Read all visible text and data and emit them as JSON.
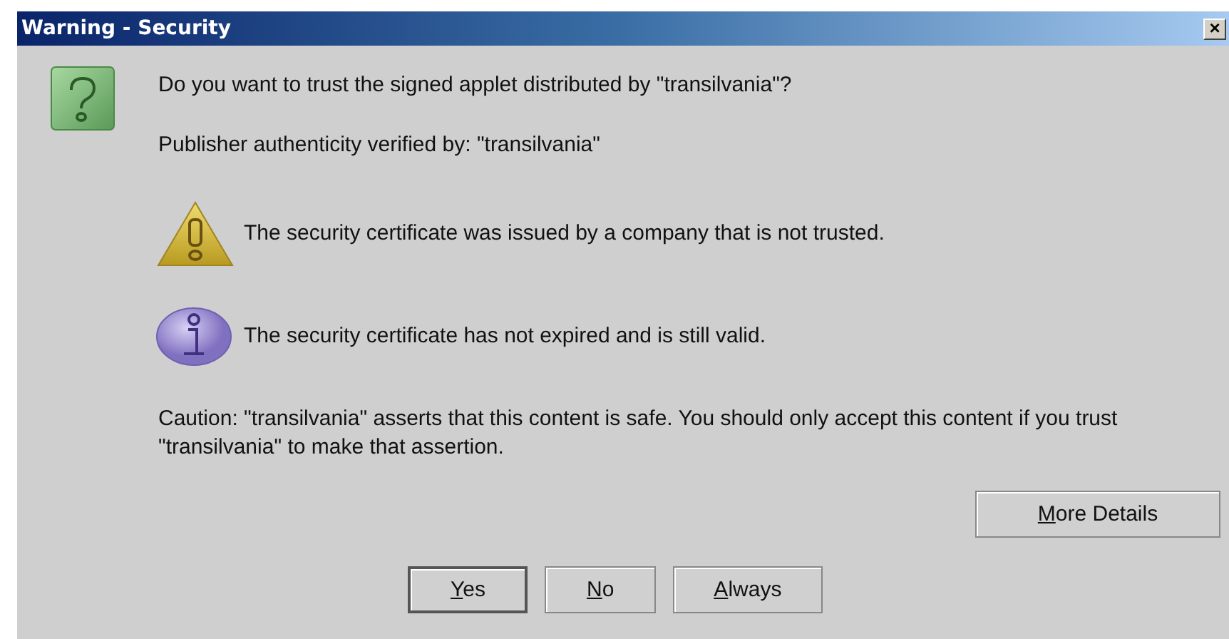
{
  "window": {
    "title": "Warning - Security",
    "close": "×"
  },
  "question": "Do you want to trust the signed applet distributed by \"transilvania\"?",
  "publisher": "Publisher authenticity verified by: \"transilvania\"",
  "notices": [
    {
      "kind": "warning",
      "text": "The security certificate was issued by a company that is not trusted."
    },
    {
      "kind": "info",
      "text": "The security certificate has not expired and is still valid."
    }
  ],
  "caution": "Caution: \"transilvania\" asserts that this content is safe. You should only accept this content if you trust \"transilvania\" to make that assertion.",
  "details_button": {
    "label": "More Details"
  },
  "buttons": [
    {
      "label": "Yes",
      "default": true
    },
    {
      "label": "No",
      "default": false
    },
    {
      "label": "Always",
      "default": false
    }
  ]
}
